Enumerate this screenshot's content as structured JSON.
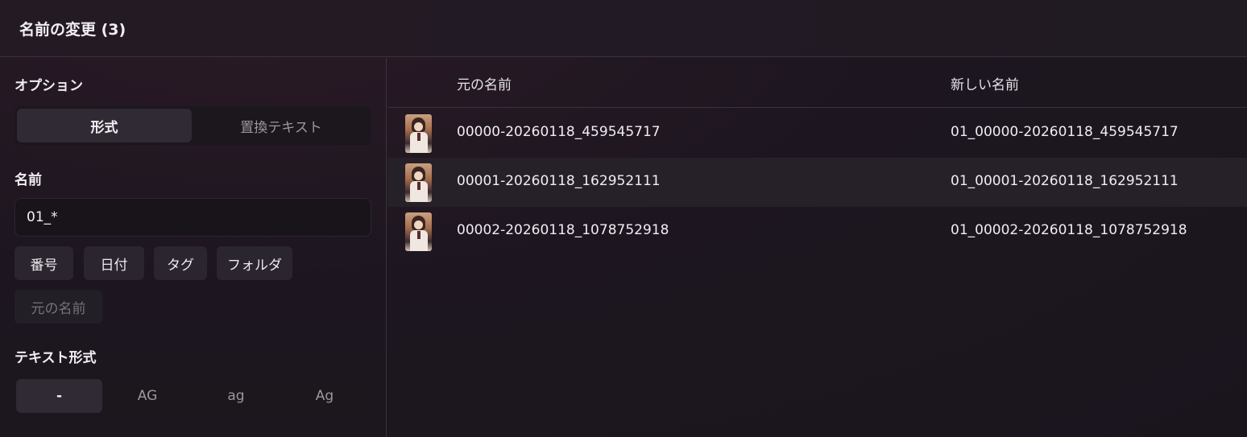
{
  "dialog": {
    "title": "名前の変更 (3)"
  },
  "options": {
    "heading": "オプション",
    "mode_tabs": [
      {
        "label": "形式",
        "active": true
      },
      {
        "label": "置換テキスト",
        "active": false
      }
    ]
  },
  "name": {
    "heading": "名前",
    "value": "01_*",
    "insert_chips": [
      {
        "label": "番号",
        "enabled": true
      },
      {
        "label": "日付",
        "enabled": true
      },
      {
        "label": "タグ",
        "enabled": true
      },
      {
        "label": "フォルダ",
        "enabled": true
      },
      {
        "label": "元の名前",
        "enabled": false
      }
    ]
  },
  "text_format": {
    "heading": "テキスト形式",
    "options": [
      {
        "label": "-",
        "active": true
      },
      {
        "label": "AG",
        "active": false
      },
      {
        "label": "ag",
        "active": false
      },
      {
        "label": "Ag",
        "active": false
      }
    ]
  },
  "table": {
    "columns": [
      "元の名前",
      "新しい名前"
    ],
    "rows": [
      {
        "original": "00000-20260118_459545717",
        "new": "01_00000-20260118_459545717",
        "highlighted": false
      },
      {
        "original": "00001-20260118_162952111",
        "new": "01_00001-20260118_162952111",
        "highlighted": true
      },
      {
        "original": "00002-20260118_1078752918",
        "new": "01_00002-20260118_1078752918",
        "highlighted": false
      }
    ]
  }
}
